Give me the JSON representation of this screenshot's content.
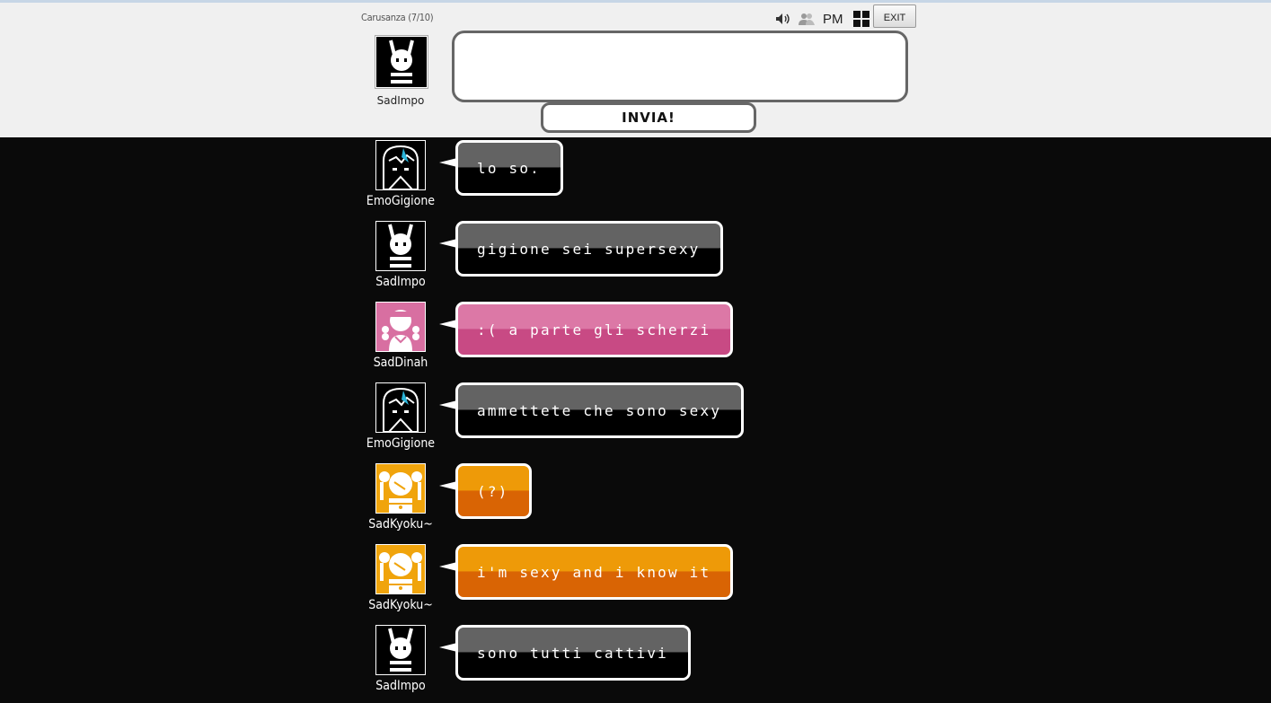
{
  "room": {
    "title": "Carusanza (7/10)"
  },
  "toolbar": {
    "icons": [
      "speaker-icon",
      "users-icon",
      "grid-icon"
    ],
    "pm_label": "PM",
    "exit_label": "EXIT"
  },
  "me": {
    "name": "SadImpo"
  },
  "composer": {
    "placeholder": "",
    "send_label": "INVIA!"
  },
  "colors": {
    "dark_top": "#636363",
    "dark_bottom": "#000000",
    "pink_top": "#dc78a6",
    "pink_bottom": "#c84a84",
    "orange_top": "#ee9a08",
    "orange_bottom": "#d96404"
  },
  "messages": [
    {
      "author": "EmoGigione",
      "text": "lo so.",
      "style": "dark",
      "avatar": "emo-avatar"
    },
    {
      "author": "SadImpo",
      "text": "gigione sei supersexy",
      "style": "dark",
      "avatar": "bunny-avatar"
    },
    {
      "author": "SadDinah",
      "text": ":( a parte gli scherzi",
      "style": "pink",
      "avatar": "girl-avatar"
    },
    {
      "author": "EmoGigione",
      "text": "ammettete che sono sexy",
      "style": "dark",
      "avatar": "emo-avatar"
    },
    {
      "author": "SadKyoku~",
      "text": "(?)",
      "style": "orange",
      "avatar": "pigtails-avatar"
    },
    {
      "author": "SadKyoku~",
      "text": "i'm sexy and i know it",
      "style": "orange",
      "avatar": "pigtails-avatar"
    },
    {
      "author": "SadImpo",
      "text": "sono tutti cattivi",
      "style": "dark",
      "avatar": "bunny-avatar"
    }
  ]
}
